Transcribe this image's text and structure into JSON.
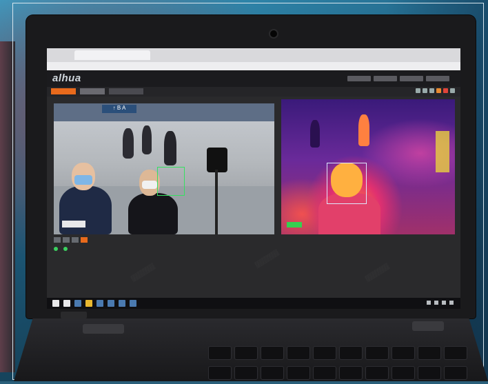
{
  "app": {
    "logo_text": "alhua"
  },
  "visible_camera": {
    "sign_text": "↑ B A"
  },
  "thermal_camera": {
    "info_text": "",
    "date_text": "",
    "target_label": ""
  },
  "colors": {
    "accent": "#e86a1c",
    "detect_box": "#35e060",
    "thermal_hot": "#ffb040",
    "thermal_cold": "#3a1a7a"
  },
  "icons": [
    "windows-start-icon",
    "search-icon",
    "file-explorer-icon",
    "browser-icon",
    "mail-icon",
    "network-tray-icon",
    "volume-tray-icon"
  ]
}
